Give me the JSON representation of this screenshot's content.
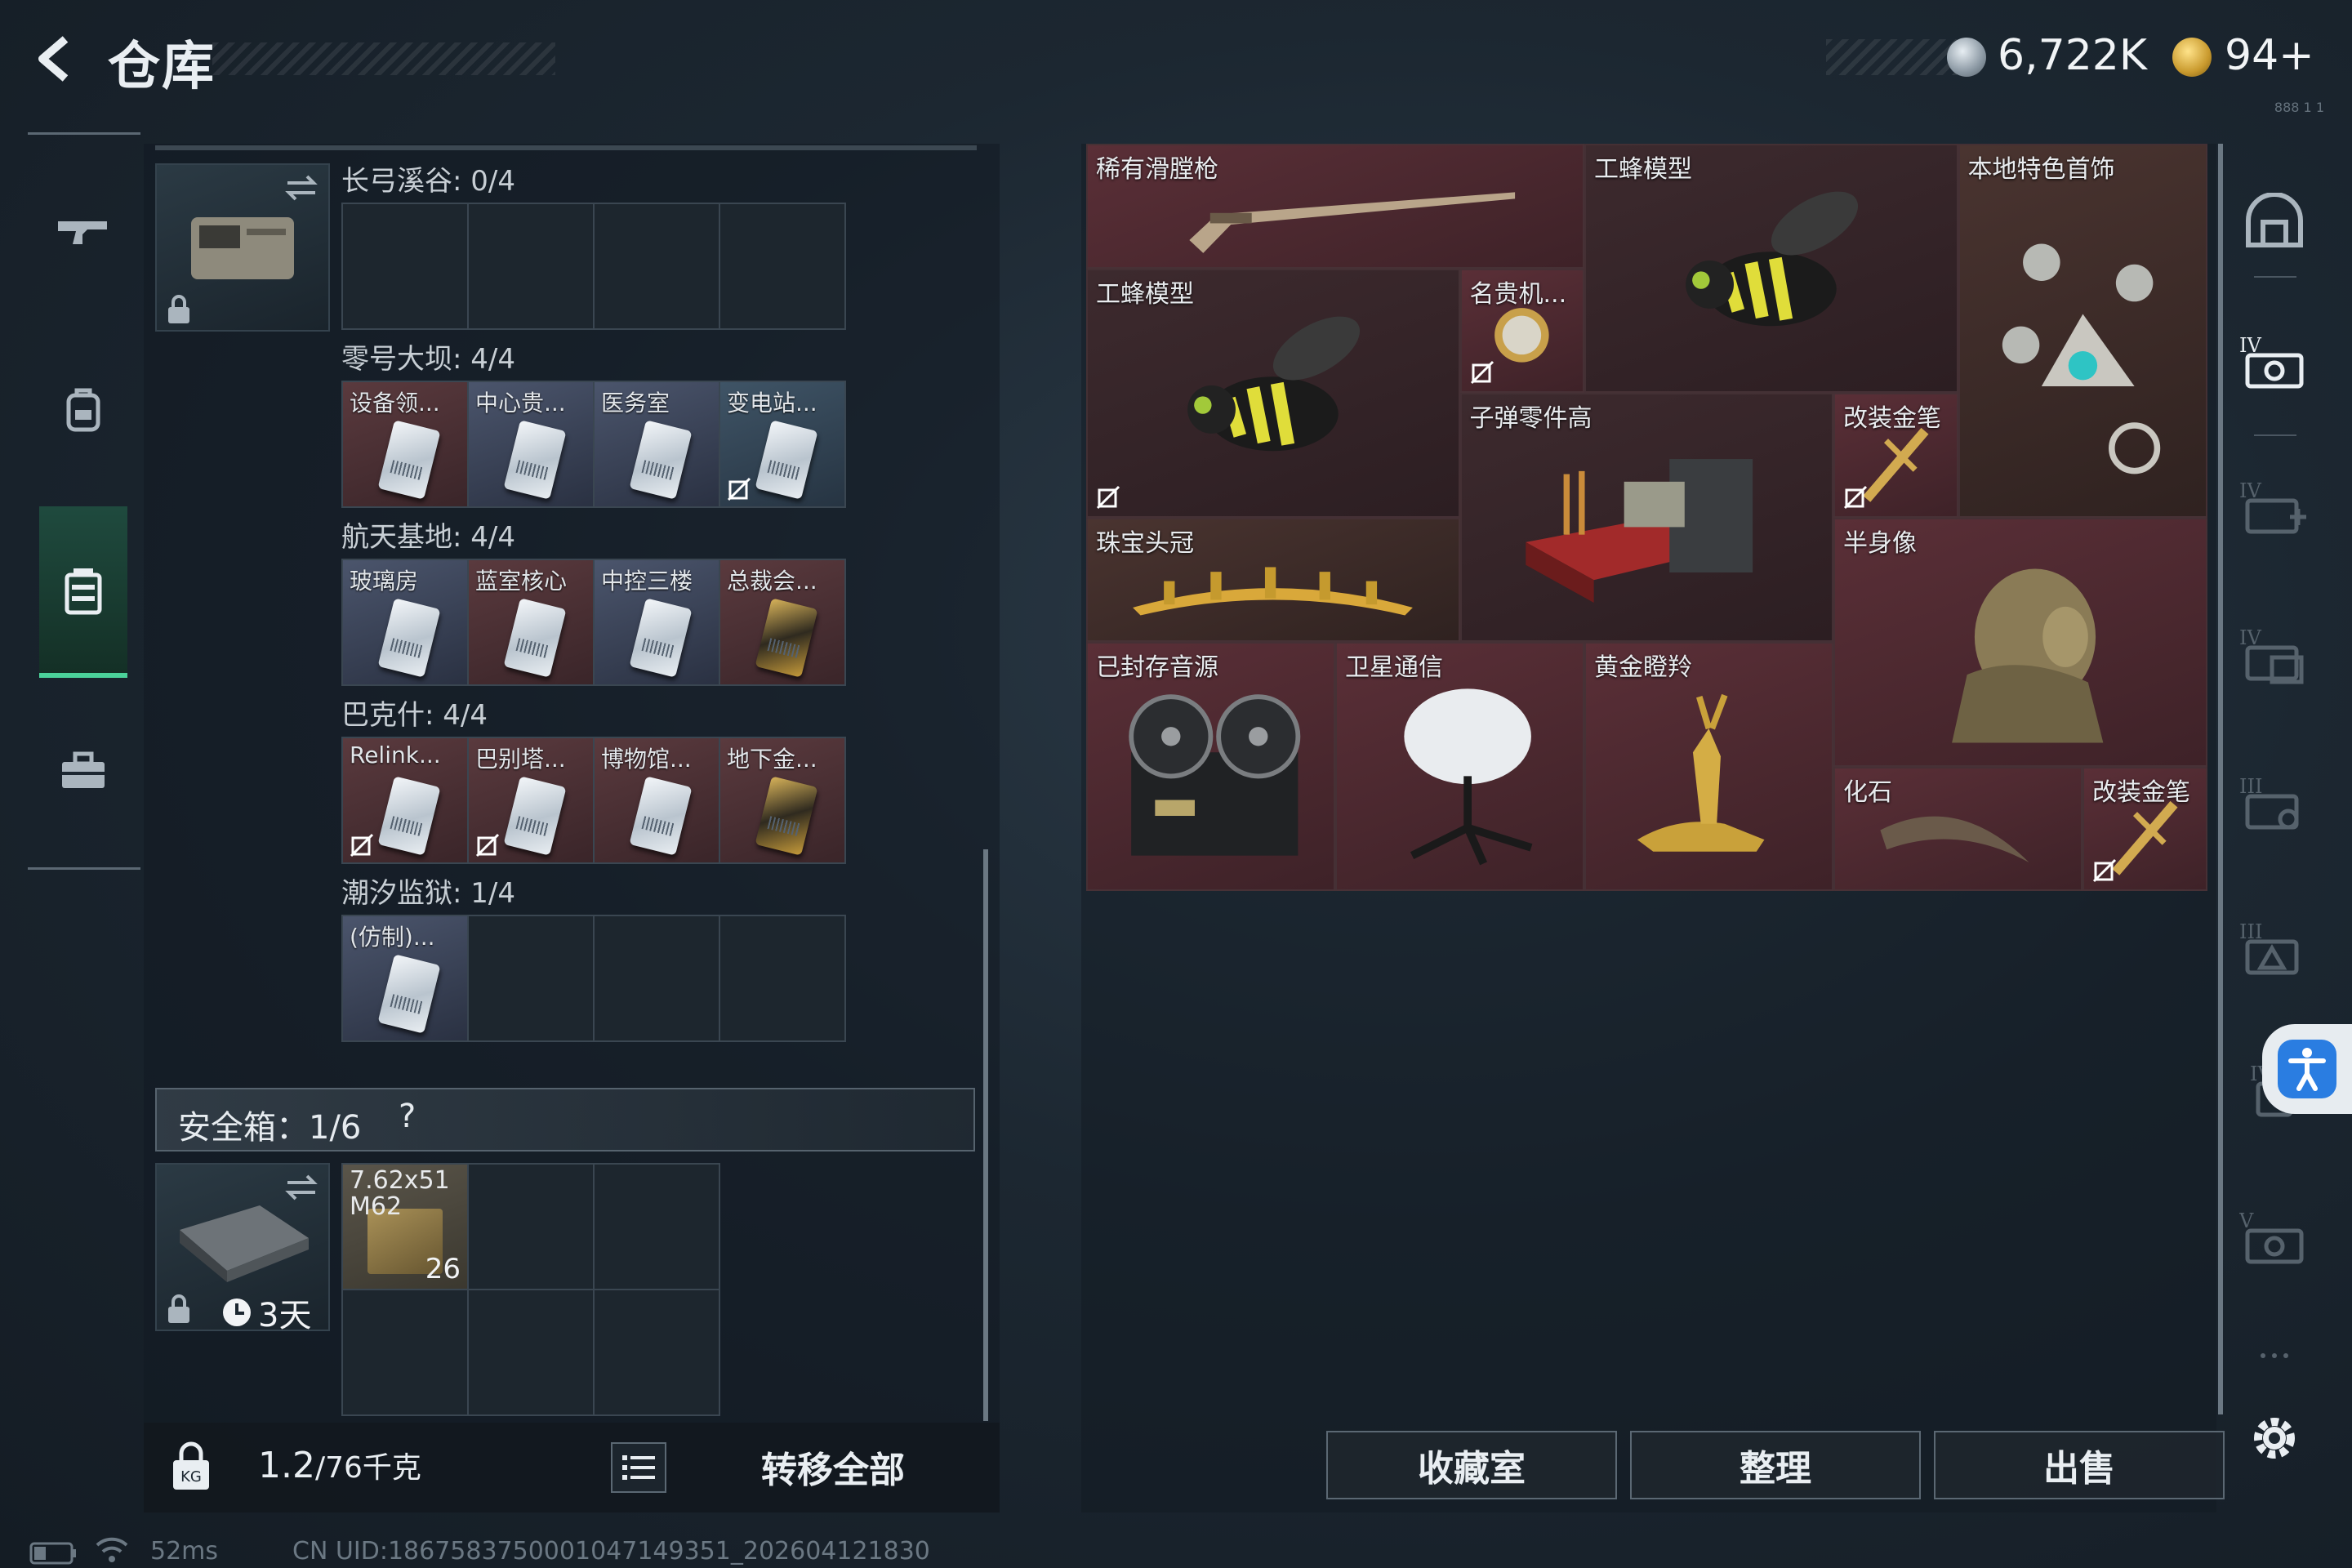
{
  "header": {
    "title": "仓库",
    "currency_silver": "6,722K",
    "currency_gold": "94+",
    "corner_tag": "888 1 1"
  },
  "left": {
    "sections": [
      {
        "name": "长弓溪谷: 0/4",
        "cards": []
      },
      {
        "name": "零号大坝: 4/4",
        "cards": [
          {
            "label": "设备领...",
            "style": "red",
            "gold": false,
            "restricted": false
          },
          {
            "label": "中心贵...",
            "style": "blue",
            "gold": false,
            "restricted": false
          },
          {
            "label": "医务室",
            "style": "blue",
            "gold": false,
            "restricted": false
          },
          {
            "label": "变电站...",
            "style": "slate",
            "gold": false,
            "restricted": true
          }
        ]
      },
      {
        "name": "航天基地: 4/4",
        "cards": [
          {
            "label": "玻璃房",
            "style": "blue",
            "gold": false,
            "restricted": false
          },
          {
            "label": "蓝室核心",
            "style": "red",
            "gold": false,
            "restricted": false
          },
          {
            "label": "中控三楼",
            "style": "blue",
            "gold": false,
            "restricted": false
          },
          {
            "label": "总裁会...",
            "style": "red",
            "gold": true,
            "restricted": false
          }
        ]
      },
      {
        "name": "巴克什: 4/4",
        "cards": [
          {
            "label": "Relink...",
            "style": "red",
            "gold": false,
            "restricted": true
          },
          {
            "label": "巴别塔...",
            "style": "red",
            "gold": false,
            "restricted": true
          },
          {
            "label": "博物馆...",
            "style": "red",
            "gold": false,
            "restricted": false
          },
          {
            "label": "地下金...",
            "style": "red",
            "gold": true,
            "restricted": false
          }
        ]
      },
      {
        "name": "潮汐监狱: 1/4",
        "cards": [
          {
            "label": "(仿制)...",
            "style": "blue",
            "gold": false,
            "restricted": false
          }
        ]
      }
    ],
    "safe_box_label": "安全箱：1/6",
    "help": "?",
    "ammo": {
      "name_line1": "7.62x51",
      "name_line2": "M62",
      "count": "26"
    },
    "timer": "3天",
    "weight_value": "1.2",
    "weight_unit": "/76千克",
    "transfer_all": "转移全部"
  },
  "stash": {
    "items": [
      {
        "label": "稀有滑膛枪",
        "bg": "red",
        "art": "musket",
        "restricted": false
      },
      {
        "label": "工蜂模型",
        "bg": "dark",
        "art": "bee",
        "restricted": false
      },
      {
        "label": "本地特色首饰",
        "bg": "brown",
        "art": "necklace",
        "restricted": false
      },
      {
        "label": "工蜂模型",
        "bg": "dark",
        "art": "bee",
        "restricted": true
      },
      {
        "label": "名贵机...",
        "bg": "red",
        "art": "watch",
        "restricted": true
      },
      {
        "label": "子弹零件高",
        "bg": "dark",
        "art": "crate",
        "restricted": false
      },
      {
        "label": "改装金笔",
        "bg": "red",
        "art": "pen",
        "restricted": true
      },
      {
        "label": "珠宝头冠",
        "bg": "brown",
        "art": "tiara",
        "restricted": false
      },
      {
        "label": "半身像",
        "bg": "red",
        "art": "bust",
        "restricted": false
      },
      {
        "label": "已封存音源",
        "bg": "red",
        "art": "reel",
        "restricted": false
      },
      {
        "label": "卫星通信",
        "bg": "red",
        "art": "dish",
        "restricted": false
      },
      {
        "label": "黄金瞪羚",
        "bg": "red",
        "art": "gazelle",
        "restricted": false
      },
      {
        "label": "化石",
        "bg": "red",
        "art": "claw",
        "restricted": false
      },
      {
        "label": "改装金笔",
        "bg": "red",
        "art": "pen",
        "restricted": true
      }
    ],
    "buttons": {
      "collection": "收藏室",
      "organize": "整理",
      "sell": "出售"
    }
  },
  "status": {
    "ping": "52ms",
    "uid": "CN UID:1867583750001047149351_202604121830"
  },
  "colors": {
    "accent_green": "#4bd29a",
    "item_red": "#5a2f37",
    "gold": "#c99a2e"
  },
  "icons": [
    "back-arrow-icon",
    "silver-coin-icon",
    "gold-coin-icon",
    "gun-icon",
    "backpack-icon",
    "vest-icon",
    "briefcase-icon",
    "swap-icon",
    "lock-icon",
    "clock-icon",
    "weight-lock-icon",
    "list-icon",
    "gear-icon",
    "accessibility-icon"
  ]
}
